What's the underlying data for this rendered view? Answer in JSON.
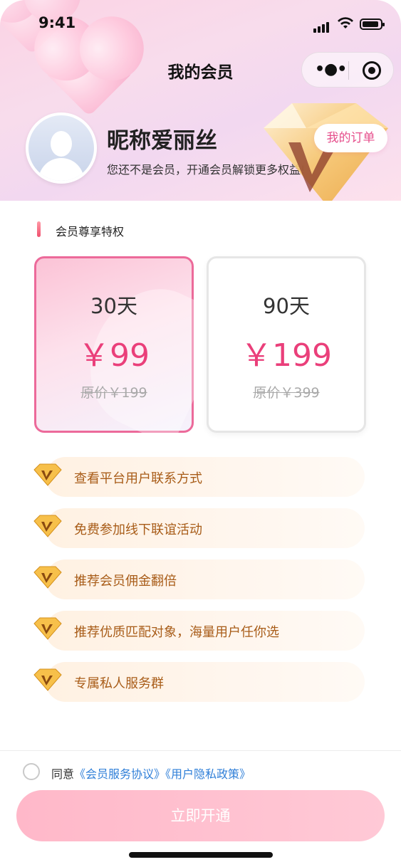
{
  "status_bar": {
    "time": "9:41"
  },
  "nav": {
    "title": "我的会员"
  },
  "profile": {
    "nickname": "昵称爱丽丝",
    "subtitle": "您还不是会员，开通会员解锁更多权益!",
    "order_button": "我的订单"
  },
  "section": {
    "title": "会员尊享特权"
  },
  "plans": [
    {
      "days": "30天",
      "price": "￥99",
      "original": "原价￥199",
      "selected": true
    },
    {
      "days": "90天",
      "price": "￥199",
      "original": "原价￥399",
      "selected": false
    }
  ],
  "benefits": [
    "查看平台用户联系方式",
    "免费参加线下联谊活动",
    "推荐会员佣金翻倍",
    "推荐优质匹配对象，海量用户任你选",
    "专属私人服务群"
  ],
  "agreement": {
    "prefix": "同意",
    "link1": "《会员服务协议》",
    "link2": "《用户隐私政策》"
  },
  "cta": {
    "label": "立即开通"
  },
  "colors": {
    "accent": "#ea3f7a",
    "benefit_text": "#a85c18",
    "link": "#2f7fd8"
  }
}
